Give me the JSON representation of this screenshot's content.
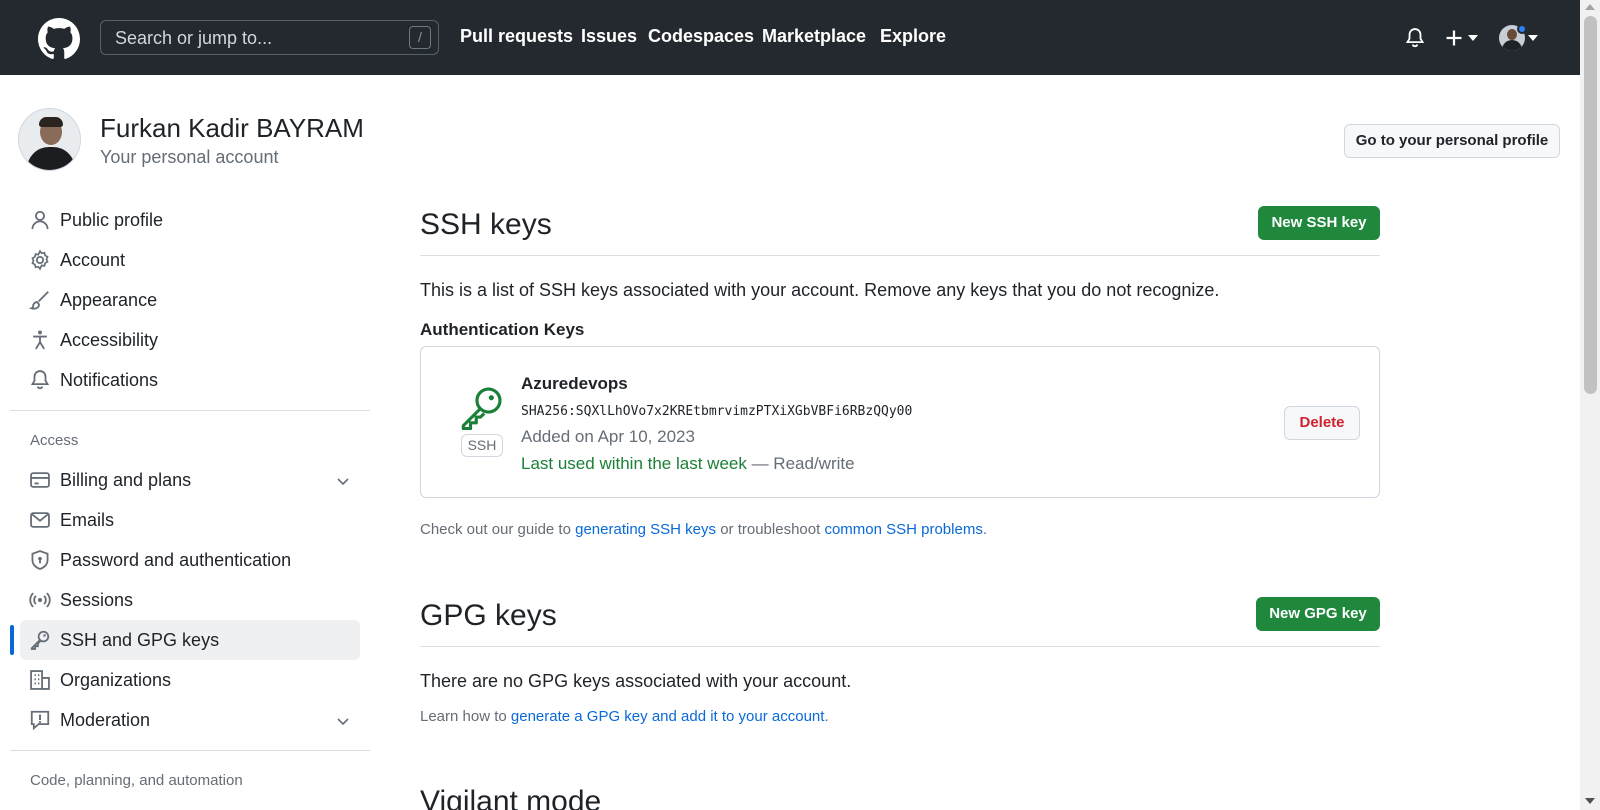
{
  "header": {
    "search_placeholder": "Search or jump to...",
    "search_shortcut": "/",
    "nav": [
      "Pull requests",
      "Issues",
      "Codespaces",
      "Marketplace",
      "Explore"
    ],
    "icons": [
      "github-logo",
      "bell-icon",
      "plus-icon",
      "chevron-down-icon",
      "avatar"
    ]
  },
  "profile": {
    "name": "Furkan Kadir BAYRAM",
    "subtitle": "Your personal account",
    "go_to_profile": "Go to your personal profile"
  },
  "sidebar": {
    "items": [
      {
        "label": "Public profile",
        "icon": "person-icon"
      },
      {
        "label": "Account",
        "icon": "gear-icon"
      },
      {
        "label": "Appearance",
        "icon": "paintbrush-icon"
      },
      {
        "label": "Accessibility",
        "icon": "accessibility-icon"
      },
      {
        "label": "Notifications",
        "icon": "bell-icon"
      }
    ],
    "access_heading": "Access",
    "access_items": [
      {
        "label": "Billing and plans",
        "icon": "credit-card-icon"
      },
      {
        "label": "Emails",
        "icon": "mail-icon"
      },
      {
        "label": "Password and authentication",
        "icon": "shield-lock-icon"
      },
      {
        "label": "Sessions",
        "icon": "broadcast-icon"
      },
      {
        "label": "SSH and GPG keys",
        "icon": "key-icon"
      },
      {
        "label": "Organizations",
        "icon": "organization-icon"
      },
      {
        "label": "Moderation",
        "icon": "report-icon"
      }
    ],
    "code_heading": "Code, planning, and automation"
  },
  "ssh": {
    "title": "SSH keys",
    "new_button": "New SSH key",
    "description": "This is a list of SSH keys associated with your account. Remove any keys that you do not recognize.",
    "auth_heading": "Authentication Keys",
    "key": {
      "badge": "SSH",
      "name": "Azuredevops",
      "fingerprint": "SHA256:SQXlLhOVo7x2KREtbmrvimzPTXiXGbVBFi6RBzQQy00",
      "added": "Added on Apr 10, 2023",
      "last_used": "Last used within the last week",
      "access": " — Read/write",
      "delete": "Delete"
    },
    "guide_prefix": "Check out our guide to ",
    "guide_link1": "generating SSH keys",
    "guide_mid": " or troubleshoot ",
    "guide_link2": "common SSH problems",
    "guide_suffix": "."
  },
  "gpg": {
    "title": "GPG keys",
    "new_button": "New GPG key",
    "empty": "There are no GPG keys associated with your account.",
    "learn_prefix": "Learn how to ",
    "learn_link": "generate a GPG key and add it to your account",
    "learn_suffix": "."
  },
  "vigilant": {
    "title": "Vigilant mode"
  },
  "colors": {
    "header_bg": "#24292f",
    "primary_button": "#1f883d",
    "link": "#0969da",
    "danger": "#cf222e",
    "active_indicator": "#0969da"
  }
}
